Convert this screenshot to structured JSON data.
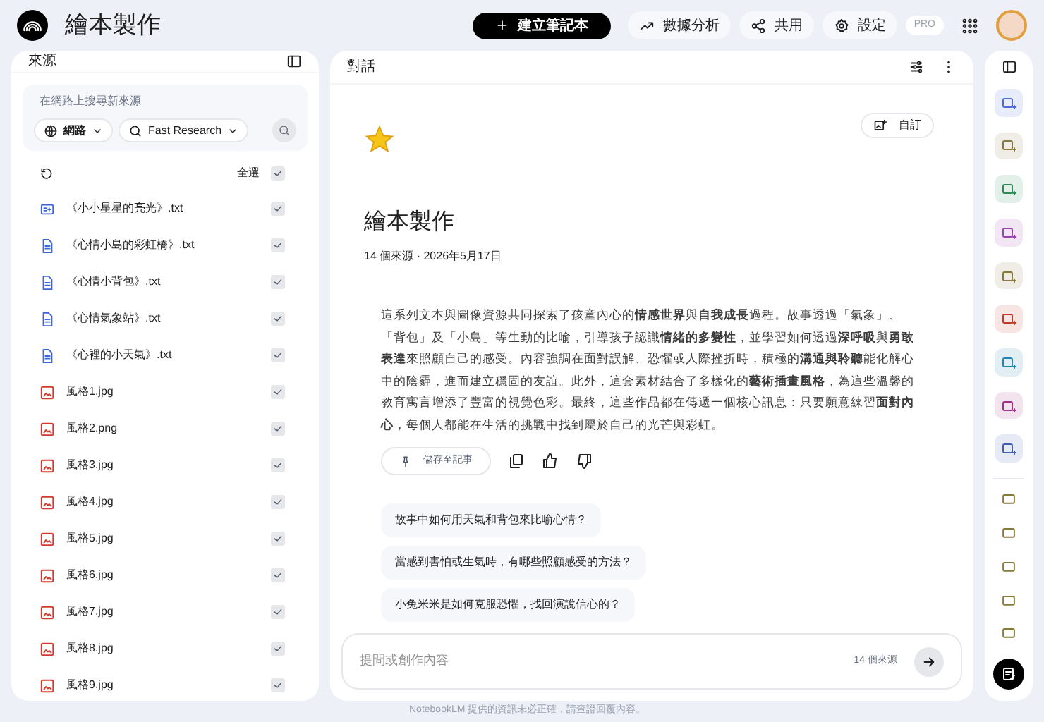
{
  "header": {
    "title": "繪本製作",
    "new_button": "建立筆記本",
    "actions": [
      {
        "kind": "analytics",
        "label": "數據分析"
      },
      {
        "kind": "share",
        "label": "共用"
      },
      {
        "kind": "settings",
        "label": "設定"
      }
    ],
    "badge": "PRO"
  },
  "sources": {
    "title": "來源",
    "search": {
      "placeholder": "在網路上搜尋新來源",
      "scope": "網路",
      "mode": "Fast Research"
    },
    "select_all": {
      "label": "全選",
      "checked": true
    },
    "items": [
      {
        "kind": "note",
        "name": "《小小星星的亮光》.txt",
        "checked": true
      },
      {
        "kind": "text",
        "name": "《心情小島的彩虹橋》.txt",
        "checked": true
      },
      {
        "kind": "text",
        "name": "《心情小背包》.txt",
        "checked": true
      },
      {
        "kind": "text",
        "name": "《心情氣象站》.txt",
        "checked": true
      },
      {
        "kind": "text",
        "name": "《心裡的小天氣》.txt",
        "checked": true
      },
      {
        "kind": "image",
        "name": "風格1.jpg",
        "checked": true
      },
      {
        "kind": "image",
        "name": "風格2.png",
        "checked": true
      },
      {
        "kind": "image",
        "name": "風格3.jpg",
        "checked": true
      },
      {
        "kind": "image",
        "name": "風格4.jpg",
        "checked": true
      },
      {
        "kind": "image",
        "name": "風格5.jpg",
        "checked": true
      },
      {
        "kind": "image",
        "name": "風格6.jpg",
        "checked": true
      },
      {
        "kind": "image",
        "name": "風格7.jpg",
        "checked": true
      },
      {
        "kind": "image",
        "name": "風格8.jpg",
        "checked": true
      },
      {
        "kind": "image",
        "name": "風格9.jpg",
        "checked": true
      }
    ]
  },
  "chat": {
    "title": "對話",
    "customize": "自訂",
    "notebook_title": "繪本製作",
    "meta": "14 個來源 · 2026年5月17日",
    "summary": "這系列文本與圖像資源共同探索了孩童內心的**情感世界**與**自我成長**過程。故事透過「氣象」、「背包」及「小島」等生動的比喻，引導孩子認識**情緒的多變性**，並學習如何透過**深呼吸**與**勇敢表達**來照顧自己的感受。內容強調在面對誤解、恐懼或人際挫折時，積極的**溝通與聆聽**能化解心中的陰霾，進而建立穩固的友誼。此外，這套素材結合了多樣化的**藝術插畫風格**，為這些溫馨的教育寓言增添了豐富的視覺色彩。最終，這些作品都在傳遞一個核心訊息：只要願意練習**面對內心**，每個人都能在生活的挑戰中找到屬於自己的光芒與彩虹。",
    "save_note": "儲存至記事",
    "suggestions": [
      "故事中如何用天氣和背包來比喻心情？",
      "當感到害怕或生氣時，有哪些照顧感受的方法？",
      "小兔米米是如何克服恐懼，找回演說信心的？"
    ],
    "input": {
      "placeholder": "提問或創作內容",
      "source_count": "14 個來源"
    }
  },
  "studio": {
    "tools": [
      {
        "color": "#4f6bd8"
      },
      {
        "color": "#8a7a3a"
      },
      {
        "color": "#2e8b57"
      },
      {
        "color": "#9c3fb0"
      },
      {
        "color": "#8a7a3a"
      },
      {
        "color": "#c0392b"
      },
      {
        "color": "#1e88b0"
      },
      {
        "color": "#a0308a"
      },
      {
        "color": "#3f5fb0"
      }
    ],
    "notes": [
      {
        "kind": "note"
      },
      {
        "kind": "note"
      },
      {
        "kind": "note"
      },
      {
        "kind": "note"
      },
      {
        "kind": "note"
      }
    ]
  },
  "footer": "NotebookLM 提供的資訊未必正確，請查證回覆內容。"
}
